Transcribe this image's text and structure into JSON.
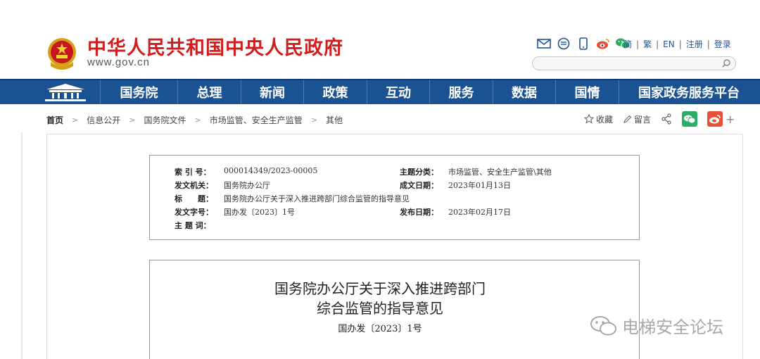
{
  "header": {
    "title": "中华人民共和国中央人民政府",
    "url": "www.gov.cn",
    "links": [
      "简",
      "繁",
      "EN",
      "注册",
      "登录"
    ]
  },
  "nav": {
    "items": [
      "国务院",
      "总理",
      "新闻",
      "政策",
      "互动",
      "服务",
      "数据",
      "国情",
      "国家政务服务平台"
    ]
  },
  "breadcrumb": [
    "首页",
    "信息公开",
    "国务院文件",
    "市场监管、安全生产监管",
    "其他"
  ],
  "tools": {
    "favorite": "收藏",
    "comment": "留言"
  },
  "meta": {
    "index_label": "索 引 号：",
    "index_value": "000014349/2023-00005",
    "category_label": "主题分类：",
    "category_value": "市场监管、安全生产监管\\其他",
    "issuer_label": "发文机关：",
    "issuer_value": "国务院办公厅",
    "date_created_label": "成文日期：",
    "date_created_value": "2023年01月13日",
    "title_label": "标　　题：",
    "title_value": "国务院办公厅关于深入推进跨部门综合监管的指导意见",
    "doc_no_label": "发文字号：",
    "doc_no_value": "国办发〔2023〕1号",
    "date_published_label": "发布日期：",
    "date_published_value": "2023年02月17日",
    "keywords_label": "主 题 词："
  },
  "document": {
    "title_line1": "国务院办公厅关于深入推进跨部门",
    "title_line2": "综合监管的指导意见",
    "number": "国办发〔2023〕1号"
  },
  "watermark": "电梯安全论坛",
  "colors": {
    "brand_red": "#d01d1d",
    "nav_blue": "#1a5292",
    "link_blue": "#1f5496",
    "wechat_green": "#2aae67",
    "weibo_red": "#e6513c"
  }
}
